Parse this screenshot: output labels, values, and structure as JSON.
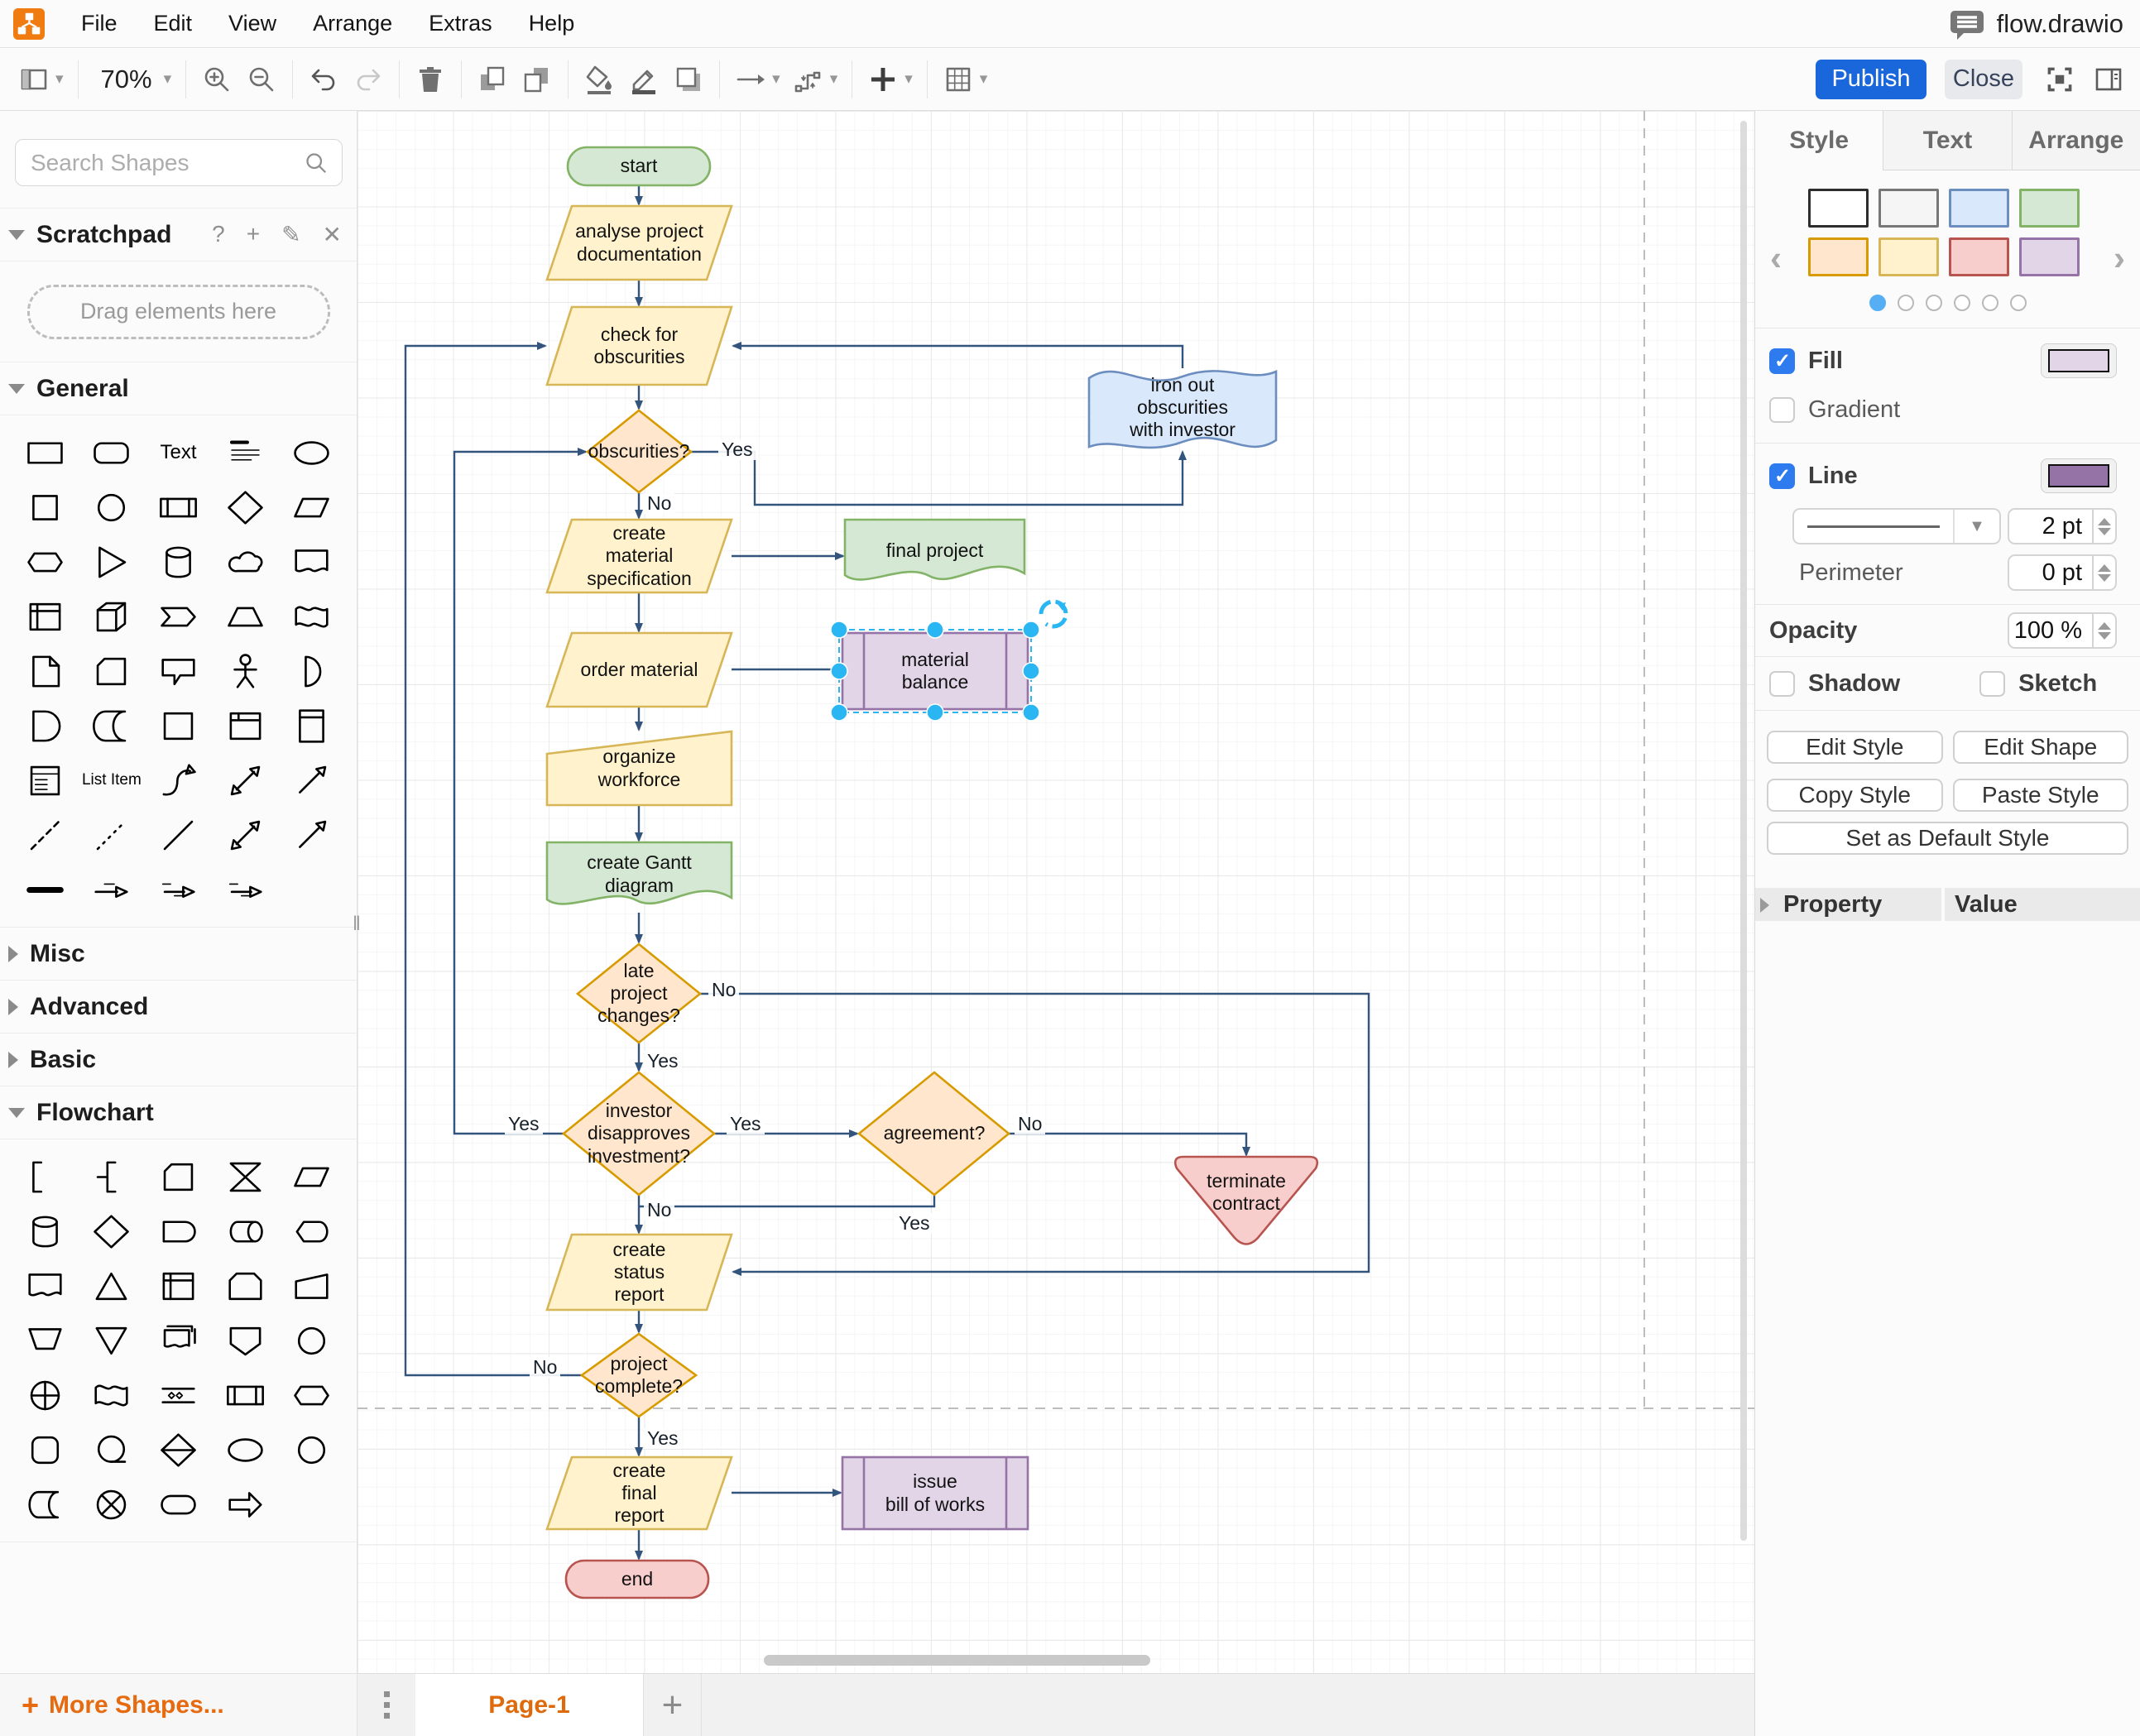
{
  "menubar": {
    "items": [
      "File",
      "Edit",
      "View",
      "Arrange",
      "Extras",
      "Help"
    ],
    "filename": "flow.drawio"
  },
  "toolbar": {
    "zoom_level": "70%",
    "publish": "Publish",
    "close": "Close"
  },
  "sidebar": {
    "search_placeholder": "Search Shapes",
    "scratchpad_title": "Scratchpad",
    "scratchpad_hint": "Drag elements here",
    "sections": {
      "general": "General",
      "misc": "Misc",
      "advanced": "Advanced",
      "basic": "Basic",
      "flowchart": "Flowchart"
    },
    "text_shape_label": "Text",
    "list_item_label": "List Item",
    "more_shapes": "More Shapes...",
    "general_shapes": [
      "rectangle",
      "rounded-rectangle",
      "text",
      "heading",
      "ellipse",
      "square",
      "circle",
      "process",
      "diamond",
      "parallelogram",
      "hexagon",
      "triangle",
      "cylinder",
      "cloud",
      "document",
      "internal-storage",
      "cube",
      "step",
      "trapezoid",
      "tape",
      "note",
      "card",
      "callout",
      "actor",
      "or",
      "and",
      "data-storage",
      "container",
      "frame",
      "vertical-container",
      "list",
      "list-item",
      "curve",
      "bidirectional-arrow",
      "arrow",
      "dashed-line",
      "dotted-line",
      "line",
      "bidirectional-connector",
      "directional-connector",
      "link",
      "arrow-with-label",
      "arrow-with-source-label",
      "arrow-with-double-label"
    ],
    "flowchart_shapes": [
      "annotation",
      "annotation-2",
      "card",
      "collate",
      "data",
      "database",
      "decision",
      "delay",
      "direct-data",
      "display",
      "document",
      "extract",
      "internal-storage",
      "loop-limit",
      "manual-input",
      "manual-operation",
      "merge",
      "multi-document",
      "off-page-reference",
      "connector",
      "or",
      "paper-tape",
      "parallel-mode",
      "predefined-process",
      "preparation",
      "rounded-rectangle",
      "sequential-data",
      "sort",
      "start",
      "start-2",
      "stored-data",
      "summing-junction",
      "terminator",
      "transfer"
    ]
  },
  "canvas": {
    "page_tab": "Page-1",
    "edge_color": "#33547D",
    "selection_color": "#29B6F2",
    "nodes": [
      {
        "id": "start",
        "type": "terminator",
        "label": "start",
        "fill": "#D5E8D4",
        "stroke": "#82B366"
      },
      {
        "id": "analyse-docs",
        "type": "parallelogram",
        "label": "analyse project\ndocumentation",
        "fill": "#FFF2CC",
        "stroke": "#D6B656"
      },
      {
        "id": "check-obscurities",
        "type": "parallelogram",
        "label": "check for\nobscurities",
        "fill": "#FFF2CC",
        "stroke": "#D6B656"
      },
      {
        "id": "obscurities",
        "type": "decision",
        "label": "obscurities?",
        "fill": "#FFE6CC",
        "stroke": "#D79B00"
      },
      {
        "id": "iron-out",
        "type": "tape",
        "label": "iron out\nobscurities\nwith investor",
        "fill": "#DAE8FC",
        "stroke": "#6C8EBF"
      },
      {
        "id": "create-material-spec",
        "type": "parallelogram",
        "label": "create\nmaterial\nspecification",
        "fill": "#FFF2CC",
        "stroke": "#D6B656"
      },
      {
        "id": "final-project",
        "type": "document",
        "label": "final project",
        "fill": "#D5E8D4",
        "stroke": "#82B366"
      },
      {
        "id": "order-material",
        "type": "parallelogram",
        "label": "order material",
        "fill": "#FFF2CC",
        "stroke": "#D6B656"
      },
      {
        "id": "material-balance",
        "type": "process",
        "label": "material\nbalance",
        "fill": "#E1D5E7",
        "stroke": "#9673A6",
        "selected": true
      },
      {
        "id": "organize-workforce",
        "type": "manual-input",
        "label": "organize\nworkforce",
        "fill": "#FFF2CC",
        "stroke": "#D6B656"
      },
      {
        "id": "create-gantt",
        "type": "document",
        "label": "create Gantt\ndiagram",
        "fill": "#D5E8D4",
        "stroke": "#82B366"
      },
      {
        "id": "late-changes",
        "type": "decision",
        "label": "late\nproject\nchanges?",
        "fill": "#FFE6CC",
        "stroke": "#D79B00"
      },
      {
        "id": "investor-disapproves",
        "type": "decision",
        "label": "investor\ndisapproves\ninvestment?",
        "fill": "#FFE6CC",
        "stroke": "#D79B00"
      },
      {
        "id": "agreement",
        "type": "decision",
        "label": "agreement?",
        "fill": "#FFE6CC",
        "stroke": "#D79B00"
      },
      {
        "id": "terminate-contract",
        "type": "merge",
        "label": "terminate\ncontract",
        "fill": "#F8CECC",
        "stroke": "#B85450"
      },
      {
        "id": "status-report",
        "type": "parallelogram",
        "label": "create\nstatus\nreport",
        "fill": "#FFF2CC",
        "stroke": "#D6B656"
      },
      {
        "id": "project-complete",
        "type": "decision",
        "label": "project\ncomplete?",
        "fill": "#FFE6CC",
        "stroke": "#D79B00"
      },
      {
        "id": "final-report",
        "type": "parallelogram",
        "label": "create\nfinal\nreport",
        "fill": "#FFF2CC",
        "stroke": "#D6B656"
      },
      {
        "id": "issue-bill",
        "type": "process",
        "label": "issue\nbill of works",
        "fill": "#E1D5E7",
        "stroke": "#9673A6"
      },
      {
        "id": "end",
        "type": "terminator",
        "label": "end",
        "fill": "#F8CECC",
        "stroke": "#B85450"
      }
    ],
    "edge_labels": [
      {
        "text": "Yes"
      },
      {
        "text": "No"
      },
      {
        "text": "No"
      },
      {
        "text": "Yes"
      },
      {
        "text": "Yes"
      },
      {
        "text": "Yes"
      },
      {
        "text": "No"
      },
      {
        "text": "No"
      },
      {
        "text": "Yes"
      },
      {
        "text": "No"
      },
      {
        "text": "Yes"
      }
    ]
  },
  "format_panel": {
    "tabs": [
      "Style",
      "Text",
      "Arrange"
    ],
    "active_tab": "Style",
    "presets": [
      {
        "fill": "#FFFFFF",
        "stroke": "#2D2D2D"
      },
      {
        "fill": "#F5F5F5",
        "stroke": "#777777"
      },
      {
        "fill": "#DAE8FC",
        "stroke": "#6C8EBF"
      },
      {
        "fill": "#D5E8D4",
        "stroke": "#82B366"
      },
      {
        "fill": "#FFE6CC",
        "stroke": "#D79B00"
      },
      {
        "fill": "#FFF2CC",
        "stroke": "#D6B656"
      },
      {
        "fill": "#F8CECC",
        "stroke": "#B85450"
      },
      {
        "fill": "#E1D5E7",
        "stroke": "#9673A6"
      }
    ],
    "fill_label": "Fill",
    "fill_color": "#E1D5E7",
    "gradient_label": "Gradient",
    "line_label": "Line",
    "line_color": "#9673A6",
    "line_width": "2 pt",
    "perimeter_label": "Perimeter",
    "perimeter_value": "0 pt",
    "opacity_label": "Opacity",
    "opacity_value": "100 %",
    "shadow_label": "Shadow",
    "sketch_label": "Sketch",
    "buttons": {
      "edit_style": "Edit Style",
      "edit_shape": "Edit Shape",
      "copy_style": "Copy Style",
      "paste_style": "Paste Style",
      "set_default": "Set as Default Style"
    },
    "property_header": "Property",
    "value_header": "Value"
  }
}
